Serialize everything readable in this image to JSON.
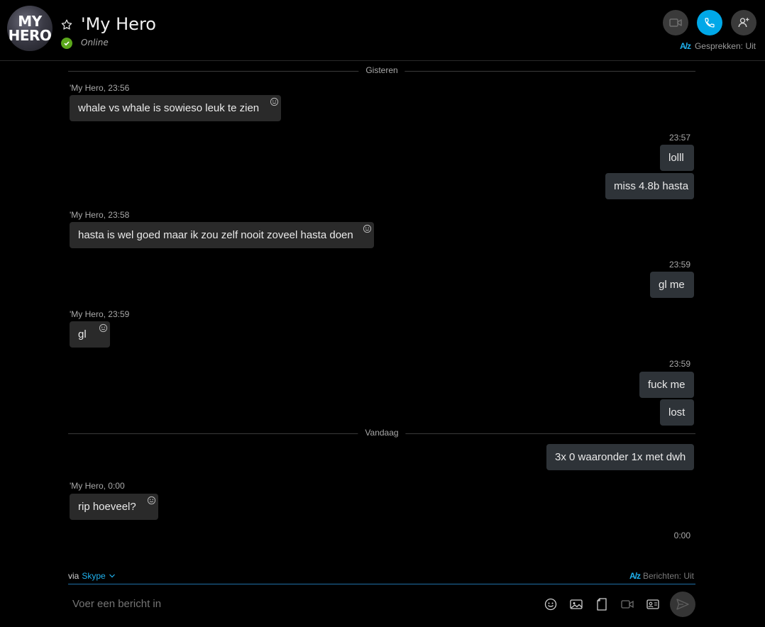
{
  "header": {
    "avatar_line1": "MY",
    "avatar_line2": "HERO",
    "title": "'My Hero",
    "status": "Online",
    "translator_label": "Gesprekken: Uit",
    "translator_icon": "translator-icon"
  },
  "chat": {
    "day_yesterday": "Gisteren",
    "day_today": "Vandaag",
    "meta_1": "'My Hero, 23:56",
    "msg_1": "whale vs whale  is sowieso leuk te zien",
    "meta_2": "23:57",
    "msg_2": "lolll",
    "msg_3": "miss 4.8b hasta",
    "meta_3": "'My Hero, 23:58",
    "msg_4": "hasta is wel goed maar ik zou zelf nooit zoveel hasta doen",
    "meta_4": "23:59",
    "msg_5": "gl me",
    "meta_5": "'My Hero, 23:59",
    "msg_6": "gl",
    "meta_6": "23:59",
    "msg_7": "fuck me",
    "msg_8": "lost",
    "msg_9": "3x 0 waaronder 1x met dwh",
    "meta_7": "'My Hero, 0:00",
    "msg_10": "rip hoeveel?",
    "meta_8": "0:00"
  },
  "composer": {
    "via_label": "via",
    "service": "Skype",
    "translator_label": "Berichten: Uit",
    "placeholder": "Voer een bericht in"
  },
  "colors": {
    "accent": "#00a8e8",
    "online": "#5ba71b",
    "incoming_bubble": "#2a2a2a",
    "outgoing_bubble": "#2e3338"
  }
}
